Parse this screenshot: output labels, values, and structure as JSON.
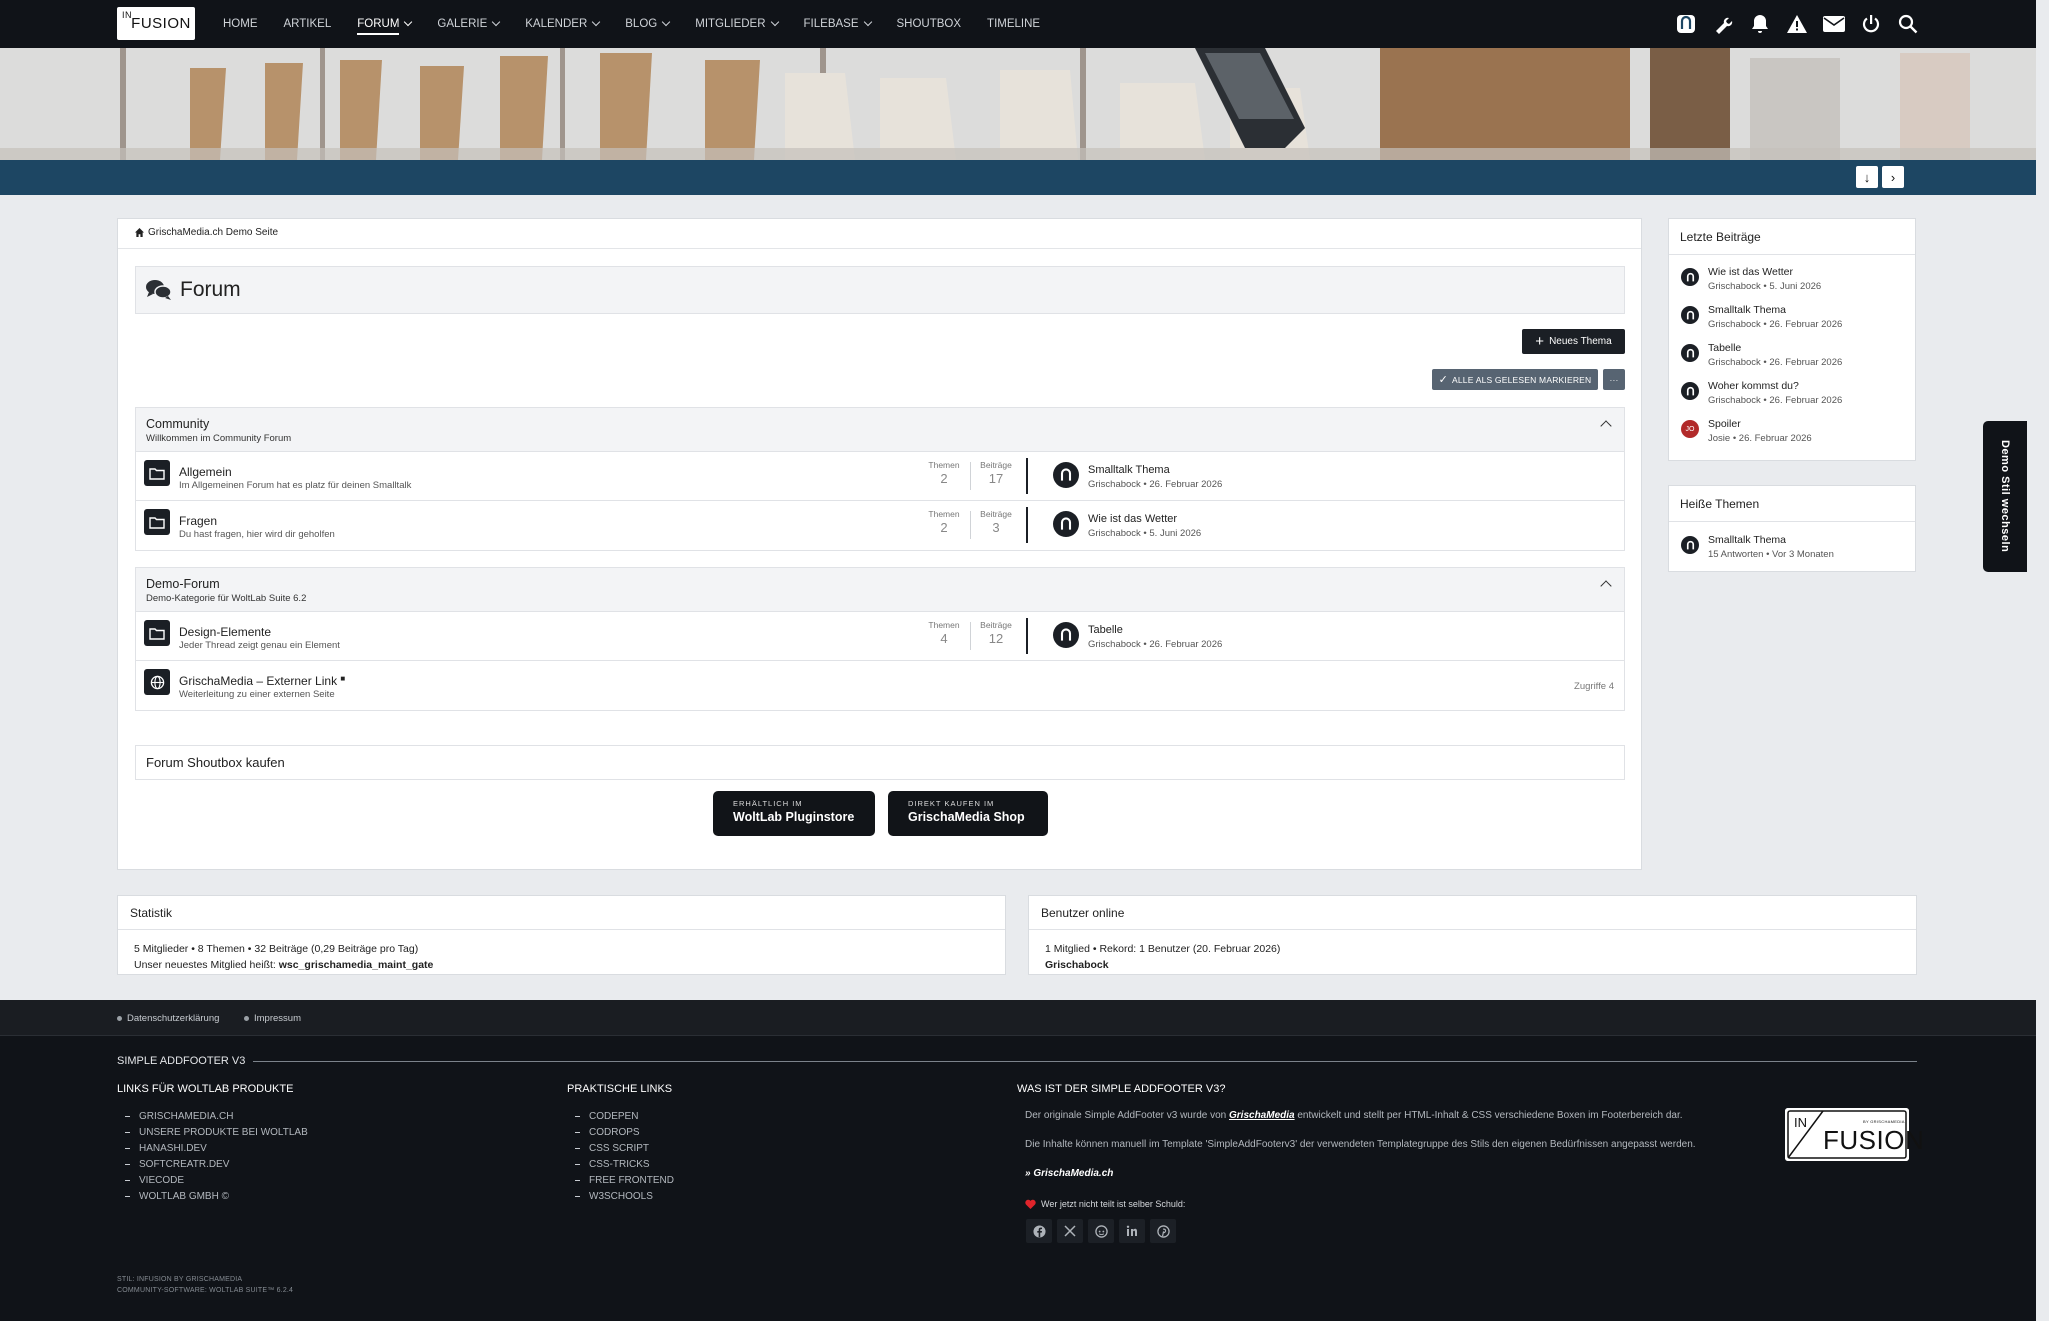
{
  "header": {
    "logo_in": "IN",
    "logo_text": "FUSION",
    "nav": [
      {
        "label": "HOME",
        "dropdown": false
      },
      {
        "label": "ARTIKEL",
        "dropdown": false
      },
      {
        "label": "FORUM",
        "dropdown": true,
        "active": true
      },
      {
        "label": "GALERIE",
        "dropdown": true
      },
      {
        "label": "KALENDER",
        "dropdown": true
      },
      {
        "label": "BLOG",
        "dropdown": true
      },
      {
        "label": "MITGLIEDER",
        "dropdown": true
      },
      {
        "label": "FILEBASE",
        "dropdown": true
      },
      {
        "label": "SHOUTBOX",
        "dropdown": false
      },
      {
        "label": "TIMELINE",
        "dropdown": false
      }
    ],
    "icons": [
      "user-avatar-icon",
      "wrench-icon",
      "bell-icon",
      "warning-icon",
      "envelope-icon",
      "power-icon",
      "search-icon"
    ]
  },
  "scroll": {
    "down": "↓",
    "right": "›"
  },
  "breadcrumb": "GrischaMedia.ch Demo Seite",
  "page": {
    "title": "Forum",
    "new_topic": "Neues Thema",
    "mark_read": "ALLE ALS GELESEN MARKIEREN",
    "more": "···"
  },
  "categories": [
    {
      "title": "Community",
      "subtitle": "Willkommen im Community Forum",
      "boards": [
        {
          "name": "Allgemein",
          "desc": "Im Allgemeinen Forum hat es platz für deinen Smalltalk",
          "themen_label": "Themen",
          "themen": "2",
          "beitraege_label": "Beiträge",
          "beitraege": "17",
          "last_title": "Smalltalk Thema",
          "last_meta": "Grischabock • 26. Februar 2026"
        },
        {
          "name": "Fragen",
          "desc": "Du hast fragen, hier wird dir geholfen",
          "themen_label": "Themen",
          "themen": "2",
          "beitraege_label": "Beiträge",
          "beitraege": "3",
          "last_title": "Wie ist das Wetter",
          "last_meta": "Grischabock • 5. Juni 2026"
        }
      ]
    },
    {
      "title": "Demo-Forum",
      "subtitle": "Demo-Kategorie für WoltLab Suite 6.2",
      "boards": [
        {
          "name": "Design-Elemente",
          "desc": "Jeder Thread zeigt genau ein Element",
          "themen_label": "Themen",
          "themen": "4",
          "beitraege_label": "Beiträge",
          "beitraege": "12",
          "last_title": "Tabelle",
          "last_meta": "Grischabock • 26. Februar 2026"
        }
      ],
      "link": {
        "name": "GrischaMedia – Externer Link",
        "desc": "Weiterleitung zu einer externen Seite",
        "hits": "Zugriffe 4"
      }
    }
  ],
  "shoutbox": {
    "title": "Forum Shoutbox kaufen",
    "btn1_top": "ERHÄLTLICH IM",
    "btn1_main": "WoltLab Pluginstore",
    "btn2_top": "DIREKT KAUFEN IM",
    "btn2_main": "GrischaMedia Shop"
  },
  "sidebar": {
    "recent_title": "Letzte Beiträge",
    "recent": [
      {
        "title": "Wie ist das Wetter",
        "meta": "Grischabock • 5. Juni 2026"
      },
      {
        "title": "Smalltalk Thema",
        "meta": "Grischabock • 26. Februar 2026"
      },
      {
        "title": "Tabelle",
        "meta": "Grischabock • 26. Februar 2026"
      },
      {
        "title": "Woher kommst du?",
        "meta": "Grischabock • 26. Februar 2026"
      },
      {
        "title": "Spoiler",
        "meta": "Josie • 26. Februar 2026",
        "initials": "JO"
      }
    ],
    "hot_title": "Heiße Themen",
    "hot": [
      {
        "title": "Smalltalk Thema",
        "meta": "15 Antworten • Vor 3 Monaten"
      }
    ]
  },
  "style_switch": "Demo Stil wechseln",
  "stats": {
    "title": "Statistik",
    "line1": "5 Mitglieder • 8 Themen • 32 Beiträge (0,29 Beiträge pro Tag)",
    "line2_pre": "Unser neuestes Mitglied heißt: ",
    "line2_name": "wsc_grischamedia_maint_gate"
  },
  "online": {
    "title": "Benutzer online",
    "line1": "1 Mitglied • Rekord: 1 Benutzer (20. Februar 2026)",
    "line2": "Grischabock"
  },
  "footer": {
    "links": [
      "Datenschutzerklärung",
      "Impressum"
    ],
    "addfooter_title": "SIMPLE ADDFOOTER V3",
    "col1_title": "LINKS FÜR WOLTLAB PRODUKTE",
    "col1": [
      "GRISCHAMEDIA.CH",
      "UNSERE PRODUKTE BEI WOLTLAB",
      "HANASHI.DEV",
      "SOFTCREATR.DEV",
      "VIECODE",
      "WOLTLAB GMBH ©"
    ],
    "col2_title": "PRAKTISCHE LINKS",
    "col2": [
      "CODEPEN",
      "CODROPS",
      "CSS SCRIPT",
      "CSS-TRICKS",
      "FREE FRONTEND",
      "W3SCHOOLS"
    ],
    "col3_title": "WAS IST DER SIMPLE ADDFOOTER V3?",
    "text1_pre": "Der originale Simple AddFooter v3 wurde von ",
    "text1_brand": "GrischaMedia",
    "text1_post": " entwickelt und stellt per HTML-Inhalt & CSS verschiedene Boxen im Footerbereich dar.",
    "text2": "Die Inhalte können manuell im Template 'SimpleAddFooterv3' der verwendeten Templategruppe des Stils den eigenen Bedürfnissen angepasst werden.",
    "site_link": "» GrischaMedia.ch",
    "share_text": "Wer jetzt nicht teilt ist selber Schuld:",
    "social": [
      "facebook-icon",
      "x-icon",
      "reddit-icon",
      "linkedin-icon",
      "pinterest-icon"
    ],
    "logo_by": "BY GRISCHAMEDIA",
    "copy1": "STIL: INFUSION BY GRISCHAMEDIA",
    "copy2": "COMMUNITY-SOFTWARE: WOLTLAB SUITE™ 6.2.4",
    "accent_heart": "#e0242b"
  }
}
